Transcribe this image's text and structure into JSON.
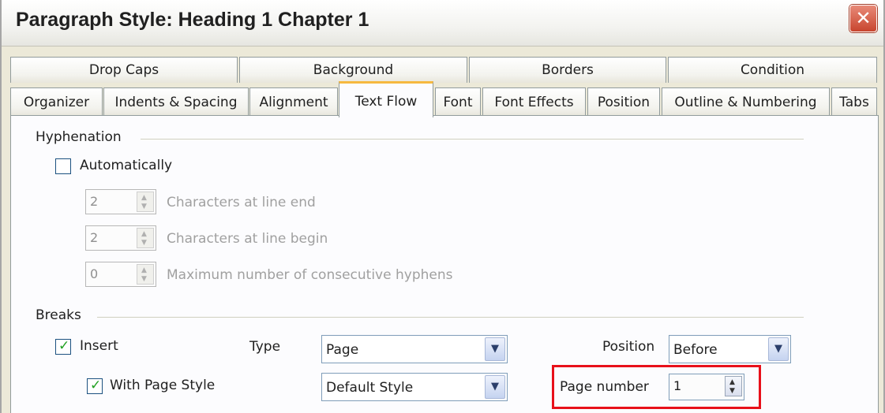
{
  "window": {
    "title": "Paragraph Style: Heading 1 Chapter 1",
    "close_symbol": "✕"
  },
  "tabs_back": [
    "Drop Caps",
    "Background",
    "Borders",
    "Condition"
  ],
  "tabs_front": [
    "Organizer",
    "Indents & Spacing",
    "Alignment",
    "Text Flow",
    "Font",
    "Font Effects",
    "Position",
    "Outline & Numbering",
    "Tabs"
  ],
  "active_tab": "Text Flow",
  "hyphenation": {
    "title": "Hyphenation",
    "automatically": "Automatically",
    "automatically_checked": false,
    "chars_end_value": "2",
    "chars_end_label": "Characters at line end",
    "chars_begin_value": "2",
    "chars_begin_label": "Characters at line begin",
    "max_hyphens_value": "0",
    "max_hyphens_label": "Maximum number of consecutive hyphens"
  },
  "breaks": {
    "title": "Breaks",
    "insert_label": "Insert",
    "insert_checked": true,
    "type_label": "Type",
    "type_value": "Page",
    "position_label": "Position",
    "position_value": "Before",
    "with_page_style_label": "With Page Style",
    "with_page_style_checked": true,
    "page_style_value": "Default Style",
    "page_number_label": "Page number",
    "page_number_value": "1"
  }
}
